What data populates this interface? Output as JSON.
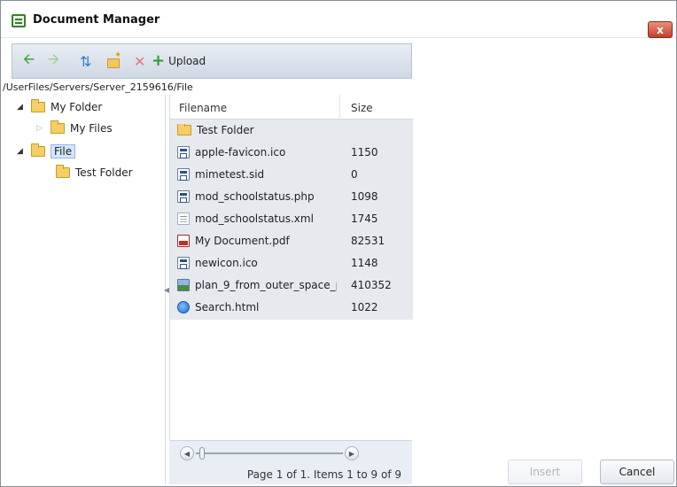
{
  "window": {
    "title": "Document Manager",
    "close_label": "x"
  },
  "toolbar": {
    "upload_label": "Upload"
  },
  "path": "/UserFiles/Servers/Server_2159616/File",
  "tree": {
    "nodes": [
      {
        "label": "My Folder"
      },
      {
        "label": "My Files"
      },
      {
        "label": "File"
      },
      {
        "label": "Test Folder"
      }
    ]
  },
  "grid": {
    "columns": {
      "filename": "Filename",
      "size": "Size"
    },
    "rows": [
      {
        "name": "Test Folder",
        "size": "",
        "icon": "folder-icon"
      },
      {
        "name": "apple-favicon.ico",
        "size": "1150",
        "icon": "app-icon"
      },
      {
        "name": "mimetest.sid",
        "size": "0",
        "icon": "app-icon"
      },
      {
        "name": "mod_schoolstatus.php",
        "size": "1098",
        "icon": "app-icon"
      },
      {
        "name": "mod_schoolstatus.xml",
        "size": "1745",
        "icon": "text-file-icon"
      },
      {
        "name": "My Document.pdf",
        "size": "82531",
        "icon": "pdf-icon"
      },
      {
        "name": "newicon.ico",
        "size": "1148",
        "icon": "app-icon"
      },
      {
        "name": "plan_9_from_outer_space_p",
        "size": "410352",
        "icon": "image-icon"
      },
      {
        "name": "Search.html",
        "size": "1022",
        "icon": "web-icon"
      }
    ]
  },
  "pager": {
    "text": "Page 1 of 1. Items 1 to 9 of 9"
  },
  "buttons": {
    "insert": "Insert",
    "cancel": "Cancel"
  }
}
